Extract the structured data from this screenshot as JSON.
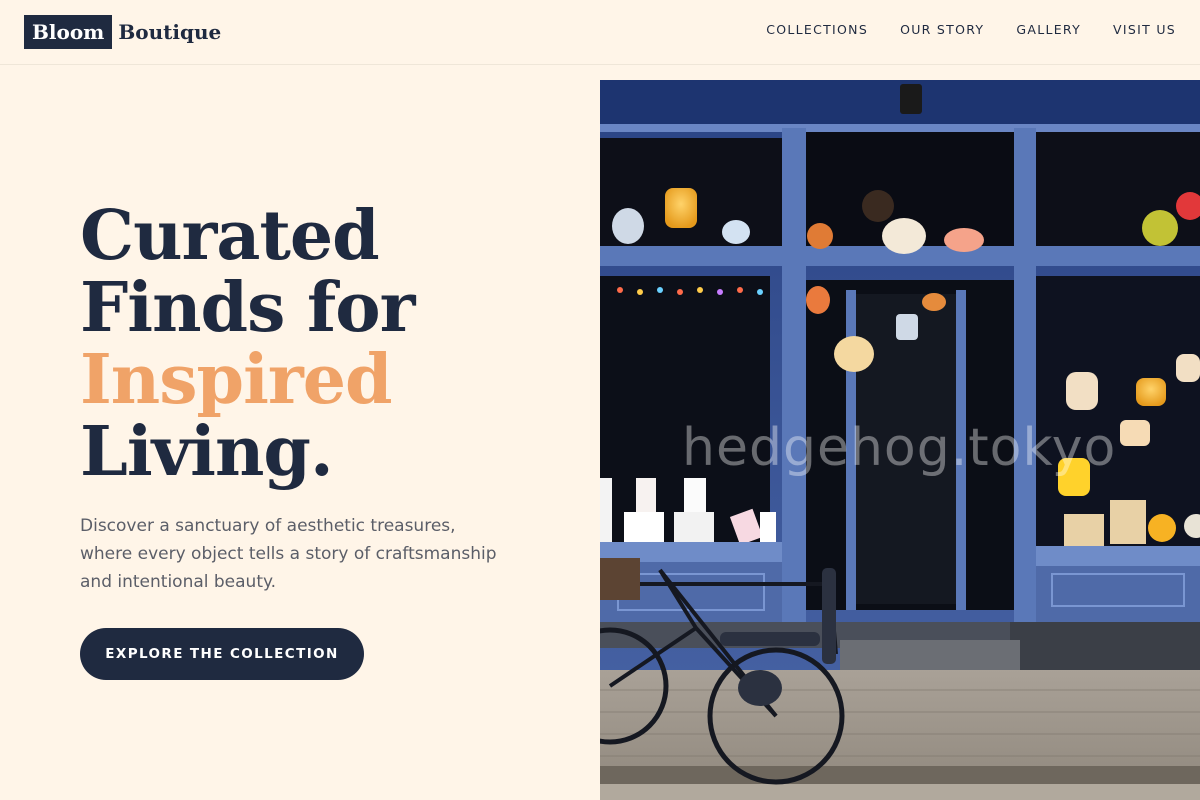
{
  "brand": {
    "logo_box_text": "Bloom",
    "logo_text": "Boutique"
  },
  "nav": {
    "items": [
      {
        "label": "COLLECTIONS"
      },
      {
        "label": "OUR STORY"
      },
      {
        "label": "GALLERY"
      },
      {
        "label": "VISIT US"
      }
    ]
  },
  "hero": {
    "title_line1": "Curated",
    "title_line2": "Finds for",
    "title_line3_accent": "Inspired",
    "title_line4": "Living.",
    "description": "Discover a sanctuary of aesthetic treasures, where every object tells a story of craftsmanship and intentional beauty.",
    "cta_label": "EXPLORE THE COLLECTION",
    "image_watermark": "hedgehog.tokyo",
    "image_alt": "Blue storefront with hanging lamps and a bicycle parked outside"
  },
  "colors": {
    "background": "#fff5e8",
    "primary": "#1f2a40",
    "accent": "#f0a368",
    "text_muted": "#5b5e68",
    "storefront_blue": "#5a78b8"
  }
}
